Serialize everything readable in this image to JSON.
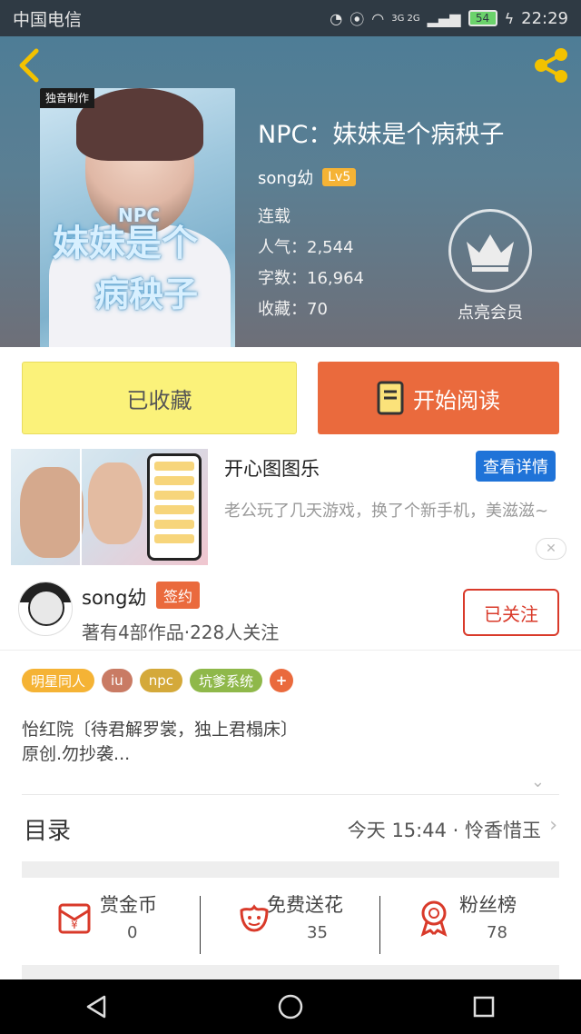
{
  "status_bar": {
    "carrier": "中国电信",
    "battery": "54",
    "time": "22:29",
    "network": "3G 2G"
  },
  "book": {
    "title": "NPC：妹妹是个病秧子",
    "author": "song幼",
    "level": "Lv5",
    "status": "连载",
    "popularity": "人气：2,544",
    "word_count": "字数：16,964",
    "favorites": "收藏：70",
    "cover_brand": "独音制作",
    "cover_npc": "NPC",
    "cover_title_line1": "妹妹是个",
    "cover_title_line2": "病秧子",
    "member_label": "点亮会员"
  },
  "actions": {
    "favorited_label": "已收藏",
    "read_label": "开始阅读"
  },
  "ad": {
    "title": "开心图图乐",
    "detail_button": "查看详情",
    "description": "老公玩了几天游戏，换了个新手机，美滋滋~"
  },
  "author_card": {
    "name": "song幼",
    "badge": "签约",
    "stats": "著有4部作品·228人关注",
    "follow_label": "已关注"
  },
  "tags": [
    {
      "label": "明星同人",
      "color": "#f5b335"
    },
    {
      "label": "iu",
      "color": "#c97b64"
    },
    {
      "label": "npc",
      "color": "#d4a93a"
    },
    {
      "label": "坑爹系统",
      "color": "#8fb84a"
    },
    {
      "label": "+",
      "color": "#ea6a3d"
    }
  ],
  "intro": {
    "line1": "怡红院〔待君解罗裳，独上君榻床〕",
    "line2": "原创.勿抄袭..."
  },
  "toc": {
    "label": "目录",
    "latest": "今天 15:44 · 怜香惜玉"
  },
  "stats": [
    {
      "label": "赏金币",
      "value": "0",
      "icon": "coin-envelope-icon"
    },
    {
      "label": "免费送花",
      "value": "35",
      "icon": "flower-icon"
    },
    {
      "label": "粉丝榜",
      "value": "78",
      "icon": "medal-icon"
    }
  ],
  "colors": {
    "accent_orange": "#ea6a3d",
    "favorite_yellow": "#fbf27a",
    "follow_red": "#d93a2a",
    "ad_blue": "#1f73d8"
  }
}
